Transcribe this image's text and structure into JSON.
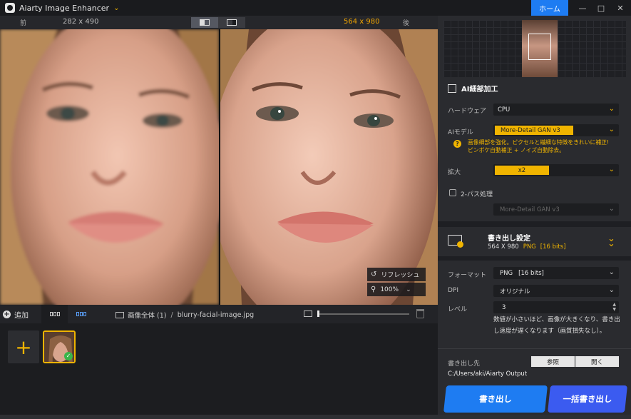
{
  "app": {
    "title": "Aiarty Image Enhancer",
    "home_label": "ホーム"
  },
  "compare": {
    "before_label": "前",
    "before_size": "282 x 490",
    "after_size": "564 x 980",
    "after_label": "後"
  },
  "viewer": {
    "refresh_label": "リフレッシュ",
    "zoom": "100%"
  },
  "files": {
    "add_label": "追加",
    "scope": "画像全体 (1)",
    "separator": "/",
    "filename": "blurry-facial-image.jpg",
    "zoom_slider_fraction": 0.0
  },
  "panel": {
    "section_title": "AI細部加工",
    "hardware_label": "ハードウェア",
    "hardware_value": "CPU",
    "model_label": "AIモデル",
    "model_value": "More-Detail GAN  v3",
    "hint_line1": "画像細部を強化。ピクセルと繊細な特徴をきれいに補正!",
    "hint_line2": "ピンボケ自動補正 + ノイズ自動除去。",
    "scale_label": "拡大",
    "scale_value": "x2",
    "twopass_label": "2-パス処理",
    "twopass_model": "More-Detail GAN  v3"
  },
  "export": {
    "title": "書き出し設定",
    "dims": "564 X 980",
    "format_tag": "PNG",
    "bits_tag": "[16 bits]",
    "format_label": "フォーマット",
    "format_value": "PNG   [16 bits]",
    "dpi_label": "DPI",
    "dpi_value": "オリジナル",
    "level_label": "レベル",
    "level_value": "3",
    "level_desc": "数値が小さいほど、画像が大きくなり、書き出し速度が遅くなります（画質損失なし）。",
    "dest_label": "書き出し先",
    "browse_label": "参照",
    "open_label": "開く",
    "path": "C:/Users/aki/Aiarty Output",
    "export_btn": "書き出し",
    "batch_btn": "一括書き出し"
  },
  "colors": {
    "accent": "#f0b400",
    "primary": "#1e7cf2",
    "batch": "#3b5bf0"
  }
}
